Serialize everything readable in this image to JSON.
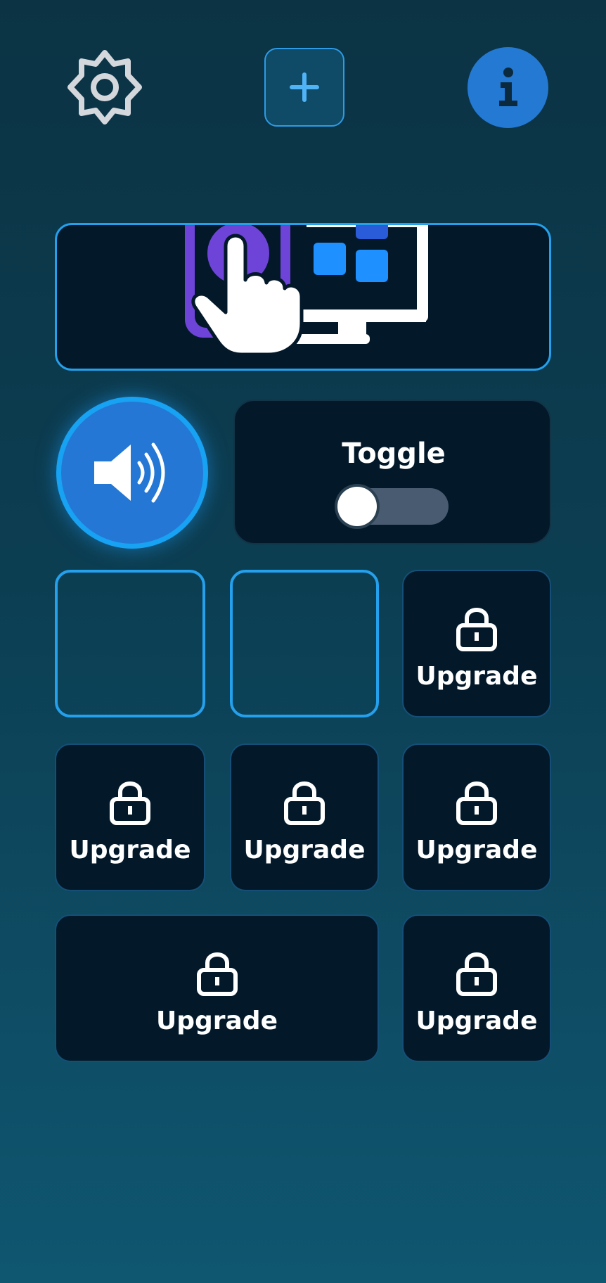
{
  "topbar": {
    "settings_icon": "gear-icon",
    "add_icon": "plus-icon",
    "info_icon": "info-icon"
  },
  "banner": {
    "image_icon": "touch-computer-icon"
  },
  "sound": {
    "icon": "speaker-icon"
  },
  "toggle": {
    "label": "Toggle",
    "state": "off"
  },
  "tiles": {
    "upgrade_label": "Upgrade",
    "lock_icon": "lock-icon"
  },
  "colors": {
    "accent": "#24a0ec",
    "button_blue": "#2479d3",
    "card_bg": "#03192a",
    "track": "#495b70"
  }
}
